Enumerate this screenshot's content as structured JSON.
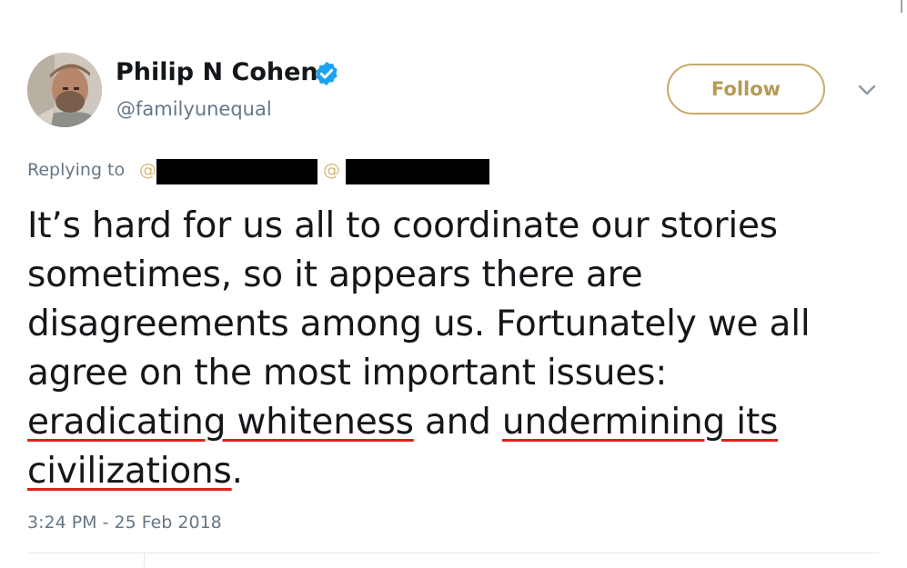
{
  "user": {
    "display_name": "Philip N Cohen",
    "handle": "@familyunequal",
    "verified": true,
    "avatar": "profile-photo"
  },
  "follow": {
    "label": "Follow"
  },
  "menu": {
    "icon": "chevron-down-icon"
  },
  "reply": {
    "prefix": "Replying to",
    "at_1": "@",
    "at_2": "@",
    "mentions_redacted": true
  },
  "tweet": {
    "line1": "It’s hard for us all to coordinate our stories",
    "line2": "sometimes, so it appears there are",
    "line3": "disagreements among us. Fortunately we all",
    "line4": "agree on the most important issues:",
    "highlight1": "eradicating whiteness",
    "connector": " and ",
    "highlight2": "undermining its",
    "highlight3": "civilizations",
    "end": "."
  },
  "meta": {
    "timestamp": "3:24 PM - 25 Feb 2018"
  },
  "colors": {
    "follow_border": "#c8a96a",
    "follow_text": "#b59a57",
    "verified_badge": "#1da1f2",
    "underline_red": "#e0201b",
    "muted_text": "#657786"
  }
}
